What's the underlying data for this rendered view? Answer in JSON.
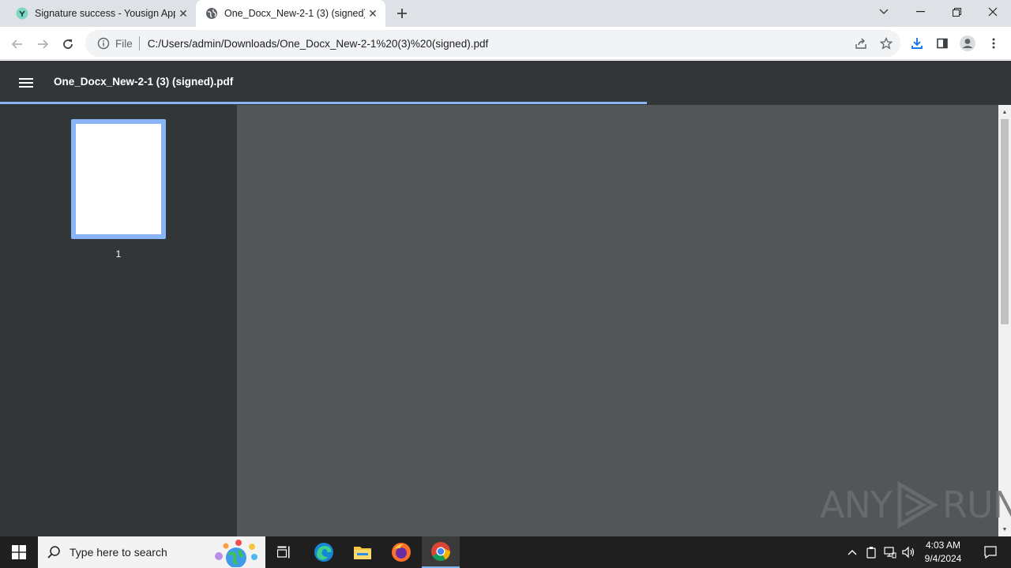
{
  "browser": {
    "tabs": [
      {
        "title": "Signature success - Yousign App",
        "favicon": "yousign-logo-icon",
        "active": false
      },
      {
        "title": "One_Docx_New-2-1 (3) (signed)",
        "favicon": "globe-icon",
        "active": true
      }
    ],
    "address": {
      "scheme_label": "File",
      "url": "C:/Users/admin/Downloads/One_Docx_New-2-1%20(3)%20(signed).pdf"
    }
  },
  "pdf_viewer": {
    "file_name": "One_Docx_New-2-1 (3) (signed).pdf",
    "page_label": "1",
    "load_progress_percent": 64,
    "accent_color": "#8ab4f8",
    "toolbar_color": "#323639",
    "canvas_color": "#525659"
  },
  "watermark": {
    "left_text": "ANY",
    "right_text": "RUN"
  },
  "taskbar": {
    "search_placeholder": "Type here to search",
    "clock_time": "4:03 AM",
    "clock_date": "9/4/2024",
    "pinned": [
      "task-view-icon",
      "edge-icon",
      "file-explorer-icon",
      "firefox-icon",
      "chrome-icon"
    ]
  }
}
